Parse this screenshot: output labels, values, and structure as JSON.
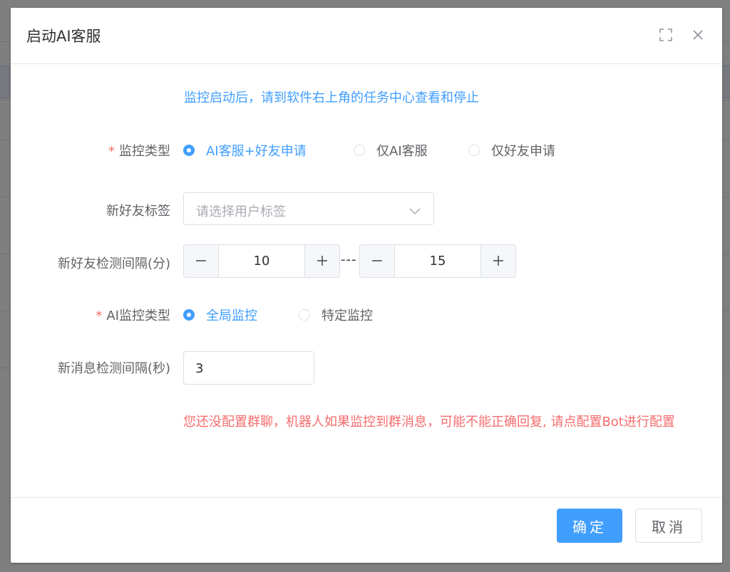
{
  "dialog": {
    "title": "启动AI客服",
    "notice": "监控启动后，请到软件右上角的任务中心查看和停止"
  },
  "form": {
    "monitor_type": {
      "label": "监控类型",
      "required": "*",
      "options": [
        "AI客服+好友申请",
        "仅AI客服",
        "仅好友申请"
      ],
      "selected": "AI客服+好友申请"
    },
    "friend_tag": {
      "label": "新好友标签",
      "placeholder": "请选择用户标签"
    },
    "friend_interval": {
      "label": "新好友检测间隔(分)",
      "min": "10",
      "max": "15",
      "separator": "---",
      "minus": "−",
      "plus": "+"
    },
    "ai_monitor_type": {
      "label": "AI监控类型",
      "required": "*",
      "options": [
        "全局监控",
        "特定监控"
      ],
      "selected": "全局监控"
    },
    "message_interval": {
      "label": "新消息检测间隔(秒)",
      "value": "3"
    },
    "warning": "您还没配置群聊，机器人如果监控到群消息，可能不能正确回复, 请点配置Bot进行配置"
  },
  "footer": {
    "confirm_label": "确定",
    "cancel_label": "取消"
  },
  "colors": {
    "primary": "#409eff",
    "danger": "#f56c6c",
    "text": "#606266"
  }
}
